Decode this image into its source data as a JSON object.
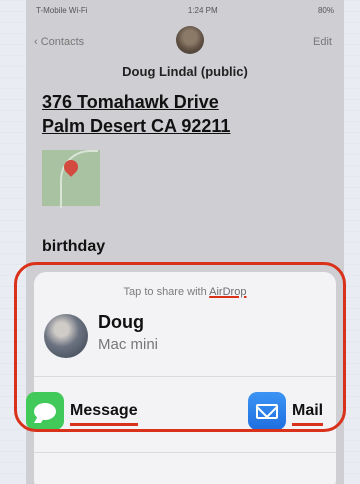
{
  "status_bar": {
    "carrier": "T-Mobile Wi-Fi",
    "time": "1:24 PM",
    "battery": "80%"
  },
  "nav": {
    "back_label": "Contacts",
    "edit_label": "Edit"
  },
  "contact": {
    "name": "Doug Lindal (public)",
    "address_line1": "376 Tomahawk Drive",
    "address_line2": "Palm Desert CA 92211",
    "birthday_label": "birthday"
  },
  "share_sheet": {
    "airdrop_prefix": "Tap to share with ",
    "airdrop_word": "AirDrop",
    "device": {
      "name": "Doug",
      "type": "Mac mini"
    },
    "apps": [
      {
        "label": "Message",
        "icon": "message-icon",
        "color": "#41c95a"
      },
      {
        "label": "Mail",
        "icon": "mail-icon",
        "color": "#2b7ff0"
      }
    ]
  },
  "annotation": {
    "color": "#d9311a"
  }
}
